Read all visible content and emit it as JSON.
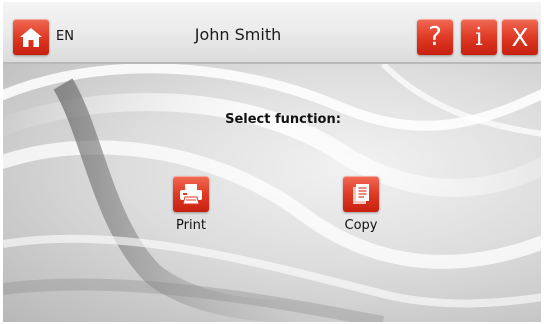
{
  "header": {
    "language": "EN",
    "user_name": "John Smith",
    "help_label": "?",
    "info_label": "i",
    "close_label": "X"
  },
  "main": {
    "prompt": "Select function:",
    "functions": [
      {
        "label": "Print",
        "icon": "printer-icon"
      },
      {
        "label": "Copy",
        "icon": "copy-document-icon"
      }
    ]
  },
  "colors": {
    "accent_red": "#df3a25",
    "topbar": "#ececec",
    "text": "#111111"
  }
}
